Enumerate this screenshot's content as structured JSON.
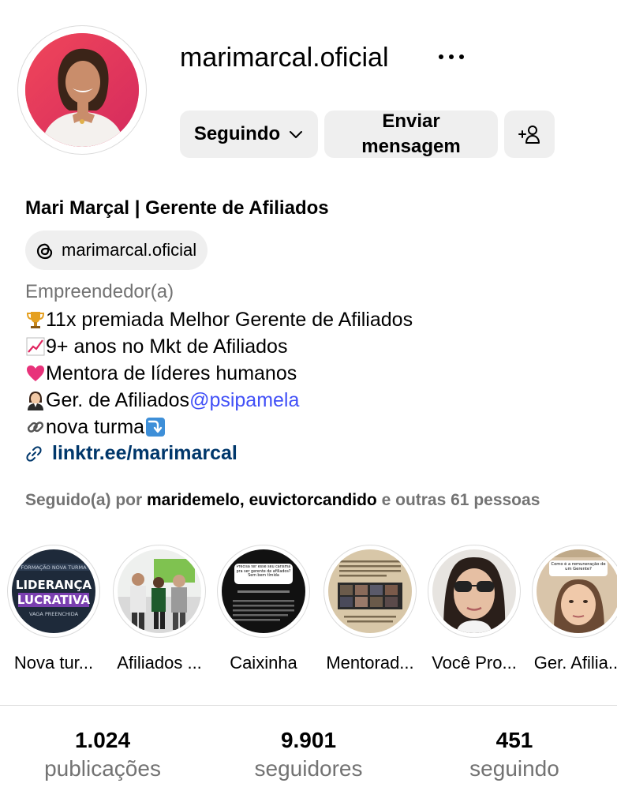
{
  "profile": {
    "username": "marimarcal.oficial",
    "full_name": "Mari Marçal | Gerente de Afiliados",
    "threads_handle": "marimarcal.oficial",
    "category": "Empreendedor(a)",
    "bio": [
      {
        "icon": "trophy-emoji",
        "text": "11x premiada Melhor Gerente de Afiliados"
      },
      {
        "icon": "chart-increasing-emoji",
        "text": "9+ anos no Mkt de Afiliados"
      },
      {
        "icon": "pink-heart-emoji",
        "text": "Mentora de líderes humanos"
      },
      {
        "icon": "woman-office-worker-emoji",
        "text": "Ger. de Afiliados ",
        "mention": "@psipamela"
      },
      {
        "icon": "link-emoji",
        "text": "nova turma ",
        "trailing_icon": "arrow-down-emoji"
      }
    ],
    "link": "linktr.ee/marimarcal"
  },
  "actions": {
    "following_label": "Seguindo",
    "message_line1": "Enviar",
    "message_line2": "mensagem"
  },
  "followed_by": {
    "prefix": "Seguido(a) por ",
    "user1": "maridemelo",
    "sep": ", ",
    "user2": "euvictorcandido",
    "suffix": " e outras 61 pessoas"
  },
  "highlights": [
    {
      "label": "Nova tur..."
    },
    {
      "label": "Afiliados ..."
    },
    {
      "label": "Caixinha"
    },
    {
      "label": "Mentorad..."
    },
    {
      "label": "Você Pro..."
    },
    {
      "label": "Ger. Afilia..."
    }
  ],
  "highlight_texts": {
    "h1_top": "FORMAÇÃO NOVA TURMA",
    "h1_big1": "LIDERANÇA",
    "h1_big2": "LUCRATIVA",
    "h1_bottom": "VAGA PREENCHIDA",
    "h3_question": "Precisa ter esse seu carisma pra ser gerente de afiliados? Sem bem tímida",
    "h6_question": "Como é a remuneração de um Gerente?"
  },
  "stats": [
    {
      "value": "1.024",
      "label": "publicações"
    },
    {
      "value": "9.901",
      "label": "seguidores"
    },
    {
      "value": "451",
      "label": "seguindo"
    }
  ],
  "colors": {
    "mention": "#4150f7",
    "link": "#00376b",
    "button_bg": "#efefef",
    "muted": "#737373"
  }
}
